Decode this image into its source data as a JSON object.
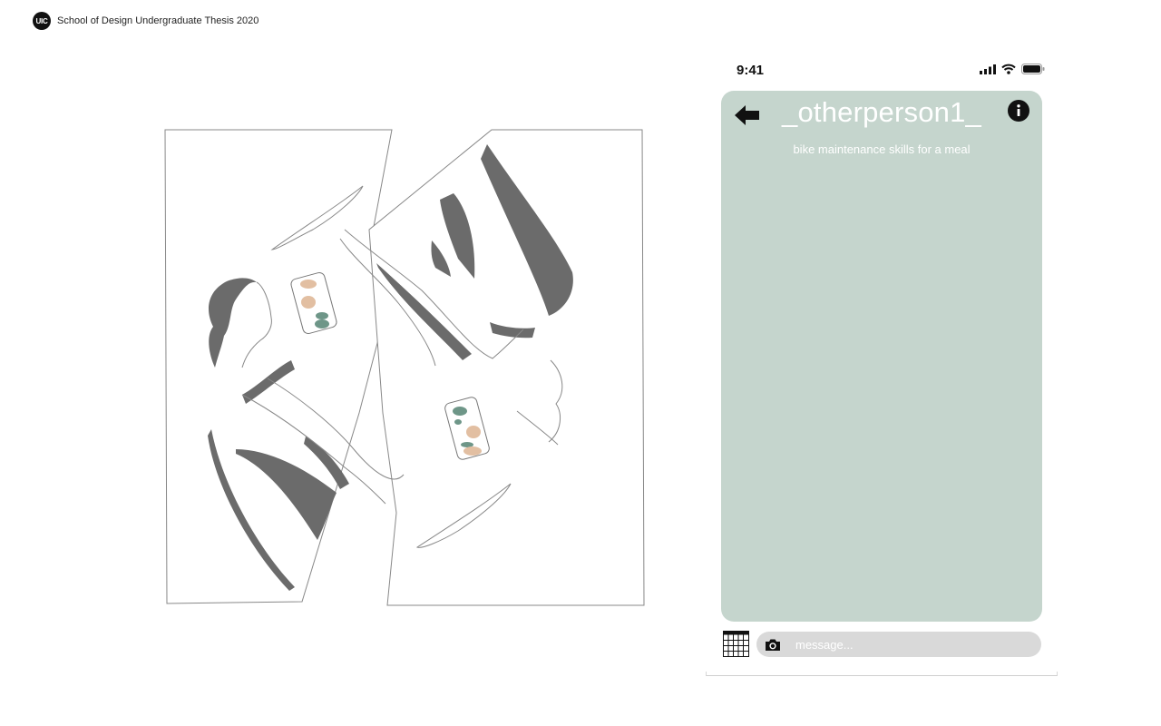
{
  "header": {
    "logo_text": "UIC",
    "site_title": "School of Design Undergraduate Thesis 2020"
  },
  "phone": {
    "status_bar": {
      "time": "9:41",
      "icons": [
        "signal-icon",
        "wifi-icon",
        "battery-icon"
      ]
    },
    "chat": {
      "contact_name": "_otherperson1_",
      "subtitle": "bike maintenance skills for a meal",
      "panel_color": "#c5d5cd",
      "icons": [
        "back-arrow-icon",
        "info-icon"
      ]
    },
    "composer": {
      "placeholder": "message...",
      "icons": [
        "calendar-icon",
        "camera-icon"
      ]
    }
  },
  "illustration": {
    "accent_colors": [
      "#6b6b6b",
      "#6e9688",
      "#e2bfa2"
    ]
  }
}
